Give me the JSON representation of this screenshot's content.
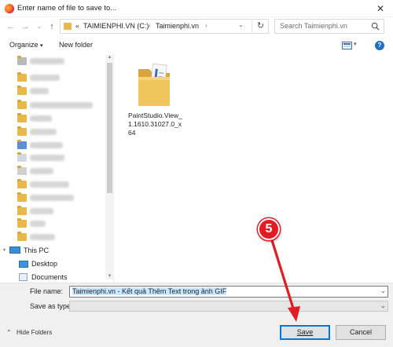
{
  "window": {
    "title": "Enter name of file to save to..."
  },
  "nav": {
    "breadcrumb_prefix": "«",
    "crumb_drive": "TAIMIENPHI.VN (C:)",
    "crumb_folder": "Taimienphi.vn",
    "search_placeholder": "Search Taimienphi.vn"
  },
  "toolbar": {
    "organize": "Organize",
    "new_folder": "New folder"
  },
  "sidebar": {
    "this_pc": "This PC",
    "desktop": "Desktop",
    "documents": "Documents",
    "blurred_items": 12
  },
  "file": {
    "name": "PaintStudio.View_1.1610.31027.0_x64"
  },
  "form": {
    "file_name_label": "File name:",
    "file_name_value": "Taimienphi.vn - Kết quả Thêm Text trong ảnh GIF",
    "save_as_label": "Save as type:",
    "save_as_value": ""
  },
  "footer": {
    "hide_folders": "Hide Folders",
    "save": "Save",
    "cancel": "Cancel"
  },
  "annotation": {
    "step": "5"
  },
  "colors": {
    "accent": "#0078d7",
    "callout": "#e31b23",
    "folder": "#e8b84a"
  }
}
